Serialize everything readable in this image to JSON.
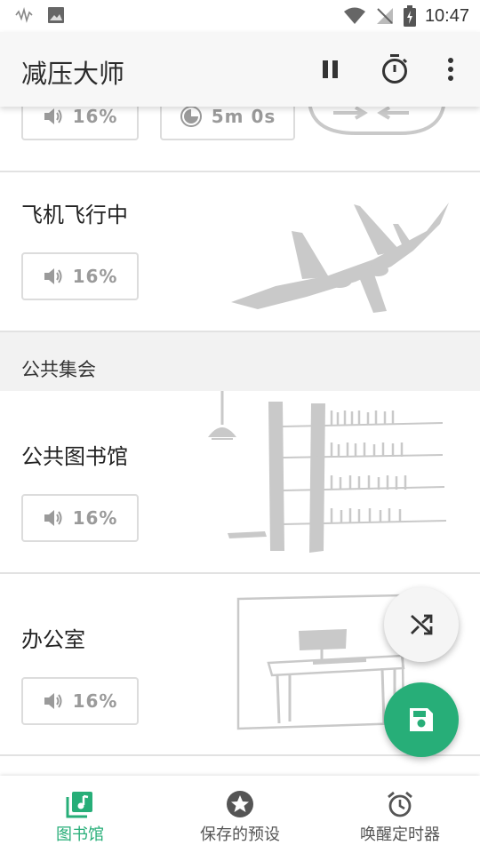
{
  "status_bar": {
    "time": "10:47"
  },
  "app_bar": {
    "title": "减压大师"
  },
  "cards": [
    {
      "name": "",
      "volume": "16%",
      "timer": "5m 0s"
    },
    {
      "name": "飞机飞行中",
      "volume": "16%"
    },
    {
      "name": "公共图书馆",
      "volume": "16%"
    },
    {
      "name": "办公室",
      "volume": "16%"
    }
  ],
  "section": {
    "title": "公共集会"
  },
  "bottom_nav": {
    "items": [
      {
        "label": "图书馆",
        "icon": "library-music-icon",
        "active": true
      },
      {
        "label": "保存的预设",
        "icon": "star-icon",
        "active": false
      },
      {
        "label": "唤醒定时器",
        "icon": "alarm-icon",
        "active": false
      }
    ]
  },
  "colors": {
    "accent": "#27ae78",
    "illustration": "#c9c9c9"
  }
}
